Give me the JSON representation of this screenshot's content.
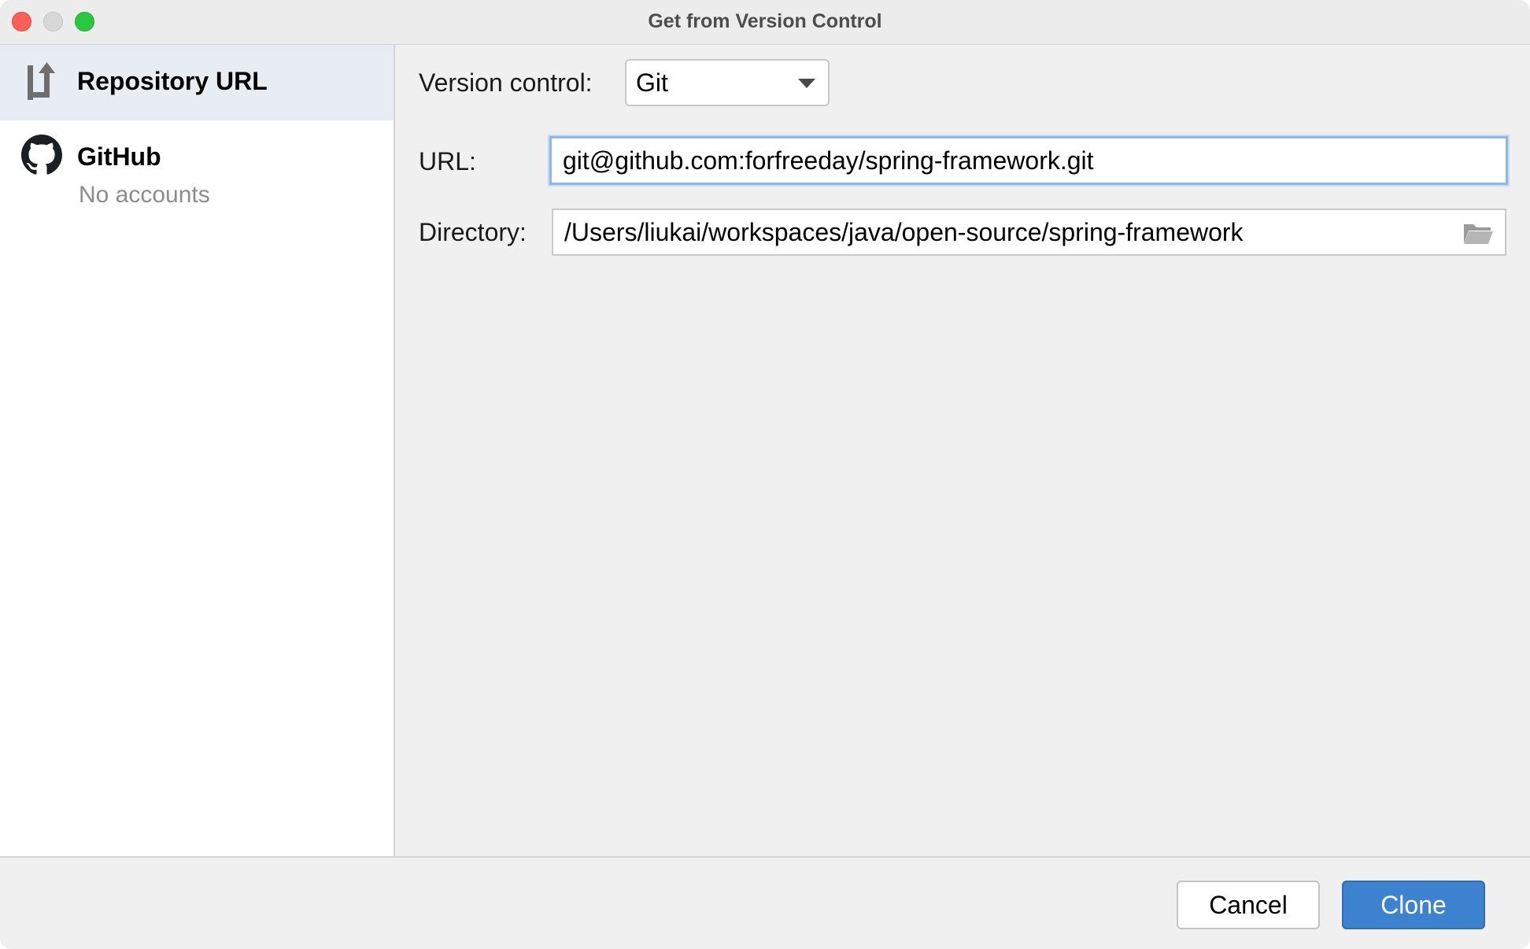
{
  "window": {
    "title": "Get from Version Control"
  },
  "sidebar": {
    "items": [
      {
        "label": "Repository URL",
        "icon": "repository-url-icon",
        "selected": true
      },
      {
        "label": "GitHub",
        "sublabel": "No accounts",
        "icon": "github-icon",
        "selected": false
      }
    ]
  },
  "form": {
    "version_control": {
      "label": "Version control:",
      "value": "Git"
    },
    "url": {
      "label": "URL:",
      "value": "git@github.com:forfreeday/spring-framework.git"
    },
    "directory": {
      "label": "Directory:",
      "value": "/Users/liukai/workspaces/java/open-source/spring-framework",
      "browse_icon": "folder-open-icon"
    }
  },
  "footer": {
    "cancel_label": "Cancel",
    "clone_label": "Clone"
  },
  "colors": {
    "selection_bg": "#e8edf4",
    "focus_ring": "#8fb8ea",
    "primary_button": "#3d82cf"
  }
}
